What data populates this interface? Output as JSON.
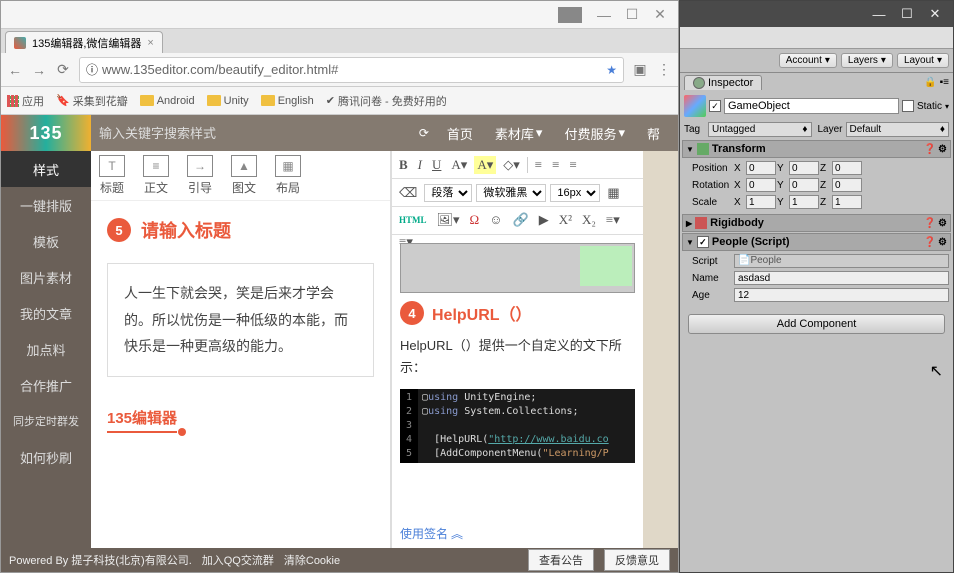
{
  "browser": {
    "tab": {
      "title": "135编辑器,微信编辑器"
    },
    "url": "www.135editor.com/beautify_editor.html#",
    "bookmarks": {
      "apps": "应用",
      "items": [
        "采集到花瓣",
        "Android",
        "Unity",
        "English"
      ],
      "extra": "腾讯问卷 - 免费好用的"
    }
  },
  "editor": {
    "rail": {
      "0": "样式",
      "1": "一键排版",
      "2": "模板",
      "3": "图片素材",
      "4": "我的文章",
      "5": "加点料",
      "6": "合作推广",
      "7": "同步定时群发",
      "8": "如何秒刷"
    },
    "search_placeholder": "输入关键字搜索样式",
    "top": {
      "0": "首页",
      "1": "素材库",
      "2": "付费服务",
      "3": "帮"
    },
    "tools": {
      "0": "标题",
      "1": "正文",
      "2": "引导",
      "3": "图文",
      "4": "布局"
    },
    "badge5": "5",
    "title_hint": "请输入标题",
    "quote": "人一生下就会哭，笑是后来才学会的。所以忧伤是一种低级的本能，而快乐是一种更高级的能力。",
    "signature": "135编辑器"
  },
  "rte": {
    "fmt": {
      "b": "B",
      "i": "I",
      "u": "U",
      "a": "A",
      "a2": "A"
    },
    "sel": {
      "para": "段落",
      "font": "微软雅黑",
      "size": "16px"
    },
    "html_btn": "HTML",
    "badge4": "4",
    "heading": "HelpURL（）",
    "body": "HelpURL（）提供一个自定义的文下所示：",
    "code": {
      "l1a": "using",
      "l1b": " UnityEngine;",
      "l2a": "using",
      "l2b": " System.Collections;",
      "l4a": "[HelpURL(",
      "l4b": "\"http://www.baidu.co",
      "l5a": "[AddComponentMenu(",
      "l5b": "\"Learning/P"
    },
    "sign_link": "使用签名"
  },
  "footer": {
    "powered": "Powered By 提子科技(北京)有限公司.",
    "qq": "加入QQ交流群",
    "cookie": "清除Cookie",
    "announce": "查看公告",
    "feedback": "反馈意见"
  },
  "unity": {
    "dd": {
      "account": "Account",
      "layers": "Layers",
      "layout": "Layout"
    },
    "inspector": "Inspector",
    "go_name": "GameObject",
    "static": "Static",
    "tag_lbl": "Tag",
    "tag_val": "Untagged",
    "layer_lbl": "Layer",
    "layer_val": "Default",
    "transform": {
      "title": "Transform",
      "pos": "Position",
      "rot": "Rotation",
      "scale": "Scale",
      "px": "0",
      "py": "0",
      "pz": "0",
      "rx": "0",
      "ry": "0",
      "rz": "0",
      "sx": "1",
      "sy": "1",
      "sz": "1"
    },
    "rigidbody": "Rigidbody",
    "people": {
      "title": "People (Script)",
      "script_lbl": "Script",
      "script_val": "People",
      "name_lbl": "Name",
      "name_val": "asdasd",
      "age_lbl": "Age",
      "age_val": "12"
    },
    "add_comp": "Add Component"
  }
}
